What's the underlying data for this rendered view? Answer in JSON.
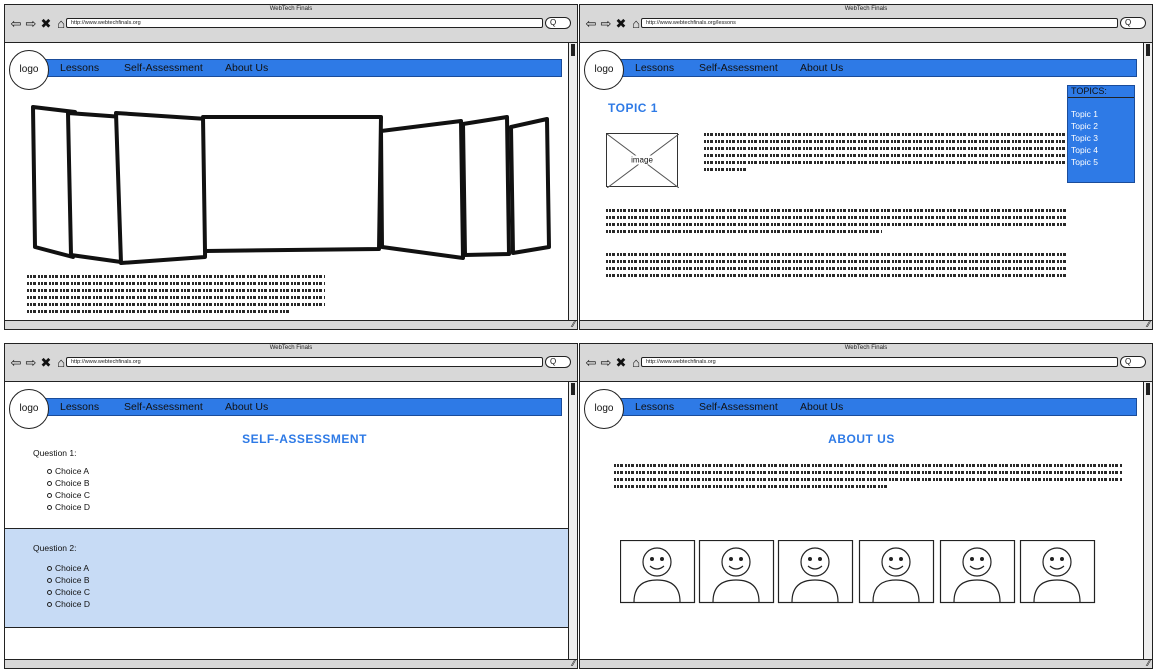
{
  "shared": {
    "app_title": "WebTech Finals",
    "nav": {
      "logo": "logo",
      "lessons": "Lessons",
      "self_assessment": "Self-Assessment",
      "about_us": "About Us"
    },
    "search_glyph": "Q",
    "accent": "#2e7ae6"
  },
  "win_home": {
    "url": "http://www.webtechfinals.org"
  },
  "win_lessons": {
    "url": "http://www.webtechfinals.org/lessons",
    "topic_title": "TOPIC 1",
    "image_label": "image",
    "topics_header": "TOPICS:",
    "topics": [
      "Topic 1",
      "Topic 2",
      "Topic 3",
      "Topic 4",
      "Topic 5"
    ]
  },
  "win_assessment": {
    "url": "http://www.webtechfinals.org",
    "title": "SELF-ASSESSMENT",
    "q1": {
      "label": "Question 1:",
      "choices": [
        "Choice A",
        "Choice B",
        "Choice C",
        "Choice D"
      ]
    },
    "q2": {
      "label": "Question 2:",
      "choices": [
        "Choice A",
        "Choice B",
        "Choice C",
        "Choice D"
      ]
    }
  },
  "win_about": {
    "url": "http://www.webtechfinals.org",
    "title": "ABOUT US"
  }
}
